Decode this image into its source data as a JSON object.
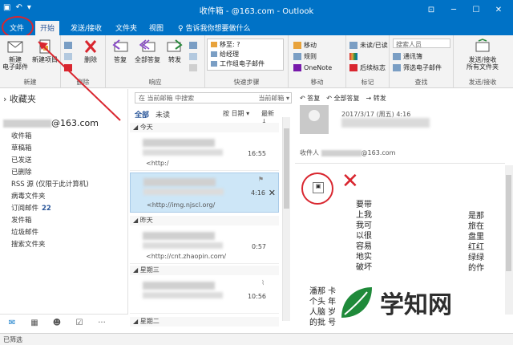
{
  "window": {
    "title": "收件箱 -           @163.com - Outlook",
    "qat_icons": [
      "save-icon",
      "undo-icon"
    ]
  },
  "tabs": [
    "文件",
    "开始",
    "发送/接收",
    "文件夹",
    "视图"
  ],
  "tell_me": "♀ 告诉我你想要做什么",
  "ribbon": {
    "new_group": {
      "label": "新建",
      "new_email": "新建\n电子邮件",
      "new_items": "新建项目"
    },
    "delete_group": {
      "label": "删除",
      "delete": "删除"
    },
    "respond_group": {
      "label": "响应",
      "reply": "答复",
      "reply_all": "全部答复",
      "forward": "转发"
    },
    "quick_steps": {
      "label": "快速步骤",
      "items": [
        "移至: ?",
        "给经理",
        "工作组电子邮件"
      ]
    },
    "move_group": {
      "label": "移动",
      "move": "移动",
      "rules": "规则",
      "onenote": "OneNote"
    },
    "tags_group": {
      "label": "标记",
      "unread_read": "未读/已读",
      "follow_up": "后续标志"
    },
    "find_group": {
      "label": "查找",
      "search_people": "搜索人员",
      "address_book": "通讯簿",
      "filter_email": "筛选电子邮件"
    },
    "sendrecv_group": {
      "label": "发送/接收",
      "sendrecv_all": "发送/接收\n所有文件夹"
    }
  },
  "folders": {
    "favorites": "收藏夹",
    "account_suffix": "@163.com",
    "items": [
      {
        "label": "收件箱"
      },
      {
        "label": "草稿箱"
      },
      {
        "label": "已发送"
      },
      {
        "label": "已删除"
      },
      {
        "label": "RSS 源 (仅限于此计算机)"
      },
      {
        "label": "病毒文件夹"
      },
      {
        "label": "订阅邮件",
        "count": "22"
      },
      {
        "label": "发件箱"
      },
      {
        "label": "垃圾邮件"
      },
      {
        "label": "搜索文件夹"
      }
    ]
  },
  "message_list": {
    "search_placeholder": "在 当前邮箱 中搜索",
    "search_scope": "当前邮箱",
    "filter_all": "全部",
    "filter_unread": "未读",
    "sort_by": "按 日期",
    "sort_order": "最新",
    "groups": [
      "今天",
      "昨天",
      "星期三",
      "星期二"
    ],
    "messages": [
      {
        "time": "16:55",
        "preview": "<http:/"
      },
      {
        "time": "4:16",
        "preview": "<http://img.njscl.org/"
      },
      {
        "time": "0:57",
        "preview": "<http://cnt.zhaopin.com/"
      },
      {
        "time": "10:56",
        "preview": ""
      }
    ]
  },
  "reading": {
    "reply": "答复",
    "reply_all": "全部答复",
    "forward": "转发",
    "date": "2017/3/17 (周五) 4:16",
    "to_label": "收件人",
    "to_suffix": "@163.com",
    "body_col1": "要带上我我可以很容易地实破坏",
    "body_col2": "是那旅在盘里红红绿绿的作",
    "body_bottom": "潘那 卡\n个头 年\n人脑 岁\n的批 号"
  },
  "statusbar": {
    "text": "已筛选"
  },
  "watermark": {
    "text": "学知网"
  },
  "colors": {
    "brand": "#0072c6",
    "annotation": "#d9262f"
  }
}
